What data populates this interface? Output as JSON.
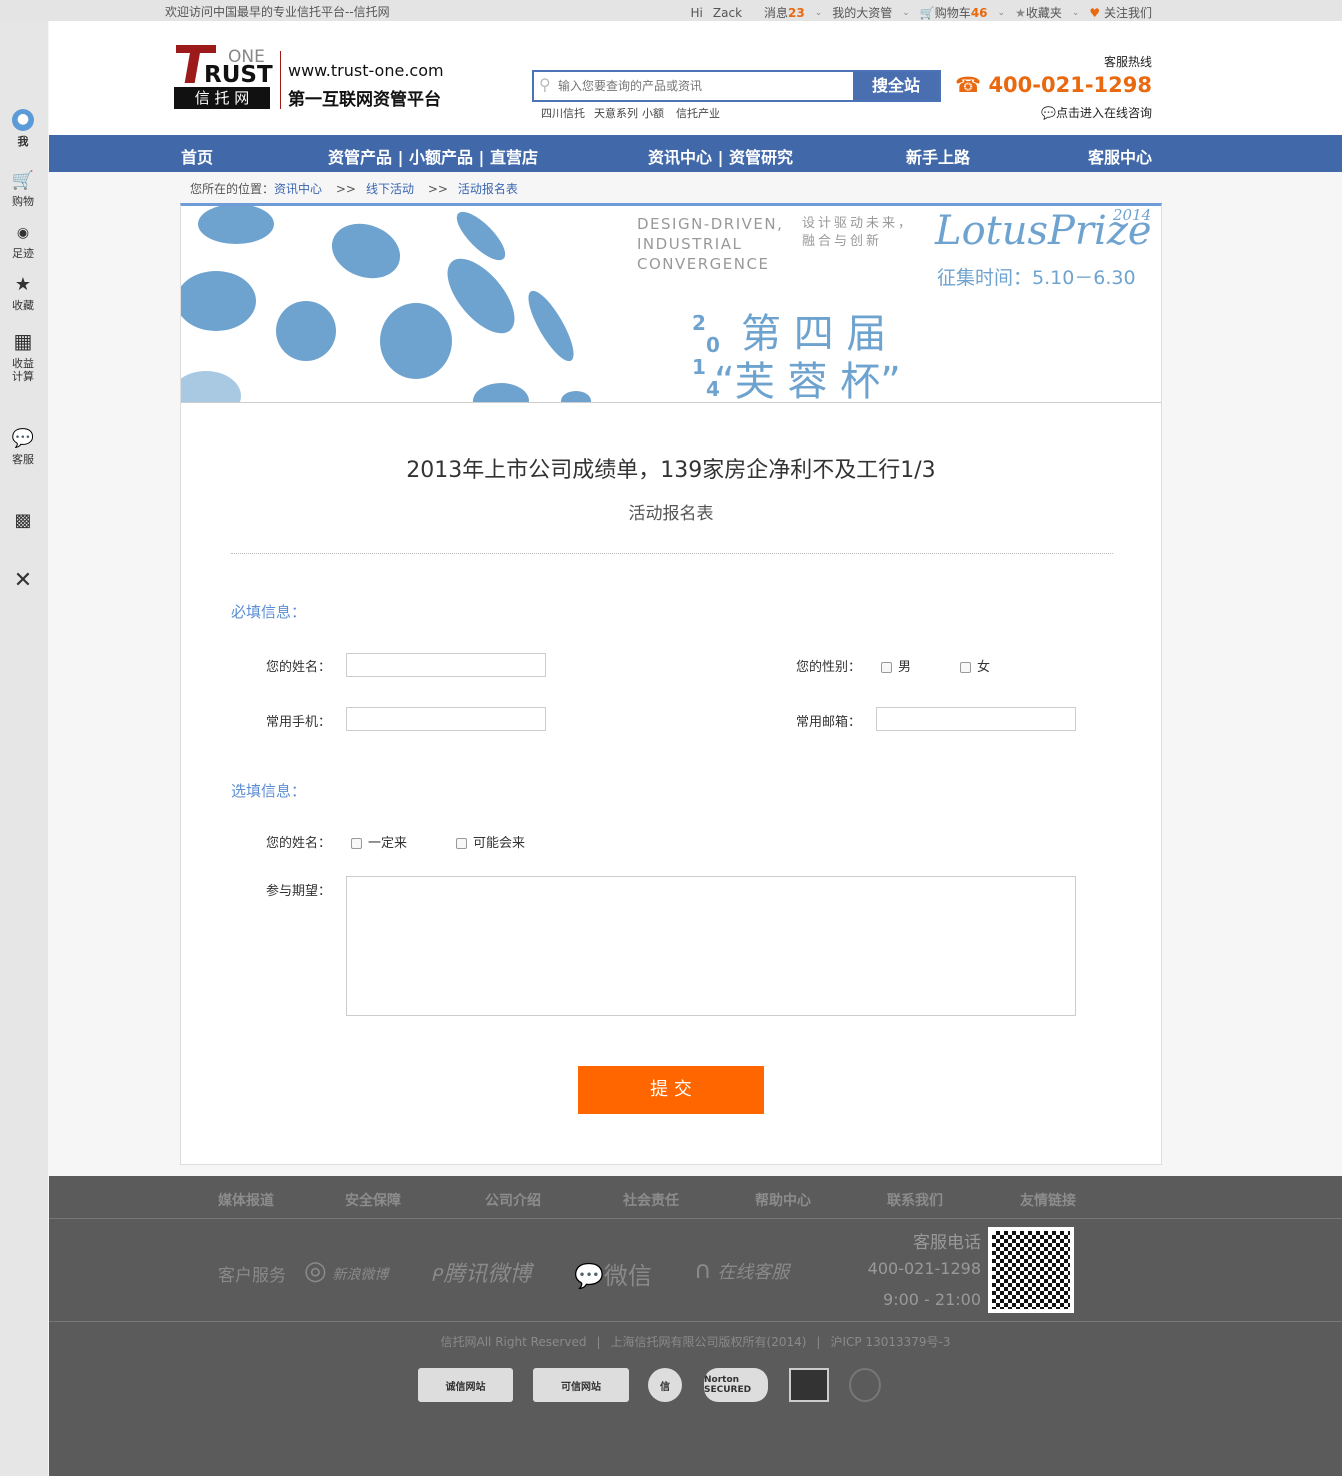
{
  "topbar": {
    "welcome": "欢迎访问中国最早的专业信托平台--信托网",
    "hi": "Hi",
    "user": "Zack",
    "messages_label": "消息",
    "messages_count": "23",
    "assets": "我的大资管",
    "cart_label": "购物车",
    "cart_count": "46",
    "favorites": "收藏夹",
    "follow": "关注我们"
  },
  "header": {
    "logo_one": "ONE",
    "logo_trust": "RUST",
    "logo_cn": "信 托 网",
    "domain": "www.trust-one.com",
    "slogan": "第一互联网资管平台",
    "search_placeholder": "输入您要查询的产品或资讯",
    "search_button": "搜全站",
    "hot_tags": [
      "四川信托",
      "天意系列",
      "小额",
      "信托产业"
    ],
    "hotline_label": "客服热线",
    "hotline": "400-021-1298",
    "online": "点击进入在线咨询"
  },
  "sidebar": {
    "items": [
      {
        "label": "我",
        "icon": "user-icon"
      },
      {
        "label": "购物",
        "icon": "cart-icon"
      },
      {
        "label": "足迹",
        "icon": "eye-icon"
      },
      {
        "label": "收藏",
        "icon": "star-icon"
      },
      {
        "label": "收益\n计算",
        "icon": "calculator-icon"
      },
      {
        "label": "客服",
        "icon": "chat-icon"
      },
      {
        "label": "",
        "icon": "qrcode-icon"
      },
      {
        "label": "",
        "icon": "close-icon"
      }
    ]
  },
  "nav": {
    "items": [
      "首页",
      "资管产品 | 小额产品 | 直营店",
      "资讯中心 | 资管研究",
      "新手上路",
      "客服中心"
    ]
  },
  "breadcrumb": {
    "prefix": "您所在的位置：",
    "items": [
      "资讯中心",
      "线下活动",
      "活动报名表"
    ],
    "sep": ">>"
  },
  "banner": {
    "en": "DESIGN-DRIVEN,\nINDUSTRIAL\nCONVERGENCE",
    "cn": "设计驱动未来，\n融合与创新",
    "brand": "LotusPrize",
    "year": "2014",
    "period": "征集时间：5.10－6.30",
    "title1": "第 四 届",
    "title2": "“芙 蓉 杯”",
    "year_digits": [
      "2",
      "0",
      "1",
      "4"
    ]
  },
  "article": {
    "title": "2013年上市公司成绩单，139家房企净利不及工行1/3",
    "subtitle": "活动报名表"
  },
  "form": {
    "required_title": "必填信息：",
    "name_label": "您的姓名：",
    "gender_label": "您的性别：",
    "male": "男",
    "female": "女",
    "phone_label": "常用手机：",
    "email_label": "常用邮箱：",
    "optional_title": "选填信息：",
    "attend_label": "您的姓名：",
    "attend_yes": "一定来",
    "attend_maybe": "可能会来",
    "expect_label": "参与期望：",
    "submit": "提 交"
  },
  "footer": {
    "links": [
      "媒体报道",
      "安全保障",
      "公司介绍",
      "社会责任",
      "帮助中心",
      "联系我们",
      "友情链接"
    ],
    "service": "客户服务",
    "social": [
      "新浪微博",
      "腾讯微博",
      "微信",
      "在线客服"
    ],
    "phone_label": "客服电话",
    "phone": "400-021-1298",
    "hours": "9:00 - 21:00",
    "copyright": [
      "信托网All Right Reserved",
      "上海信托网有限公司版权所有(2014)",
      "沪ICP 13013379号-3"
    ],
    "badges": [
      "诚信网站",
      "可信网站",
      "信",
      "Norton SECURED"
    ]
  },
  "colors": {
    "nav": "#4169aa",
    "accent": "#e8690f",
    "submit": "#ff6600",
    "link": "#3a66b0"
  }
}
